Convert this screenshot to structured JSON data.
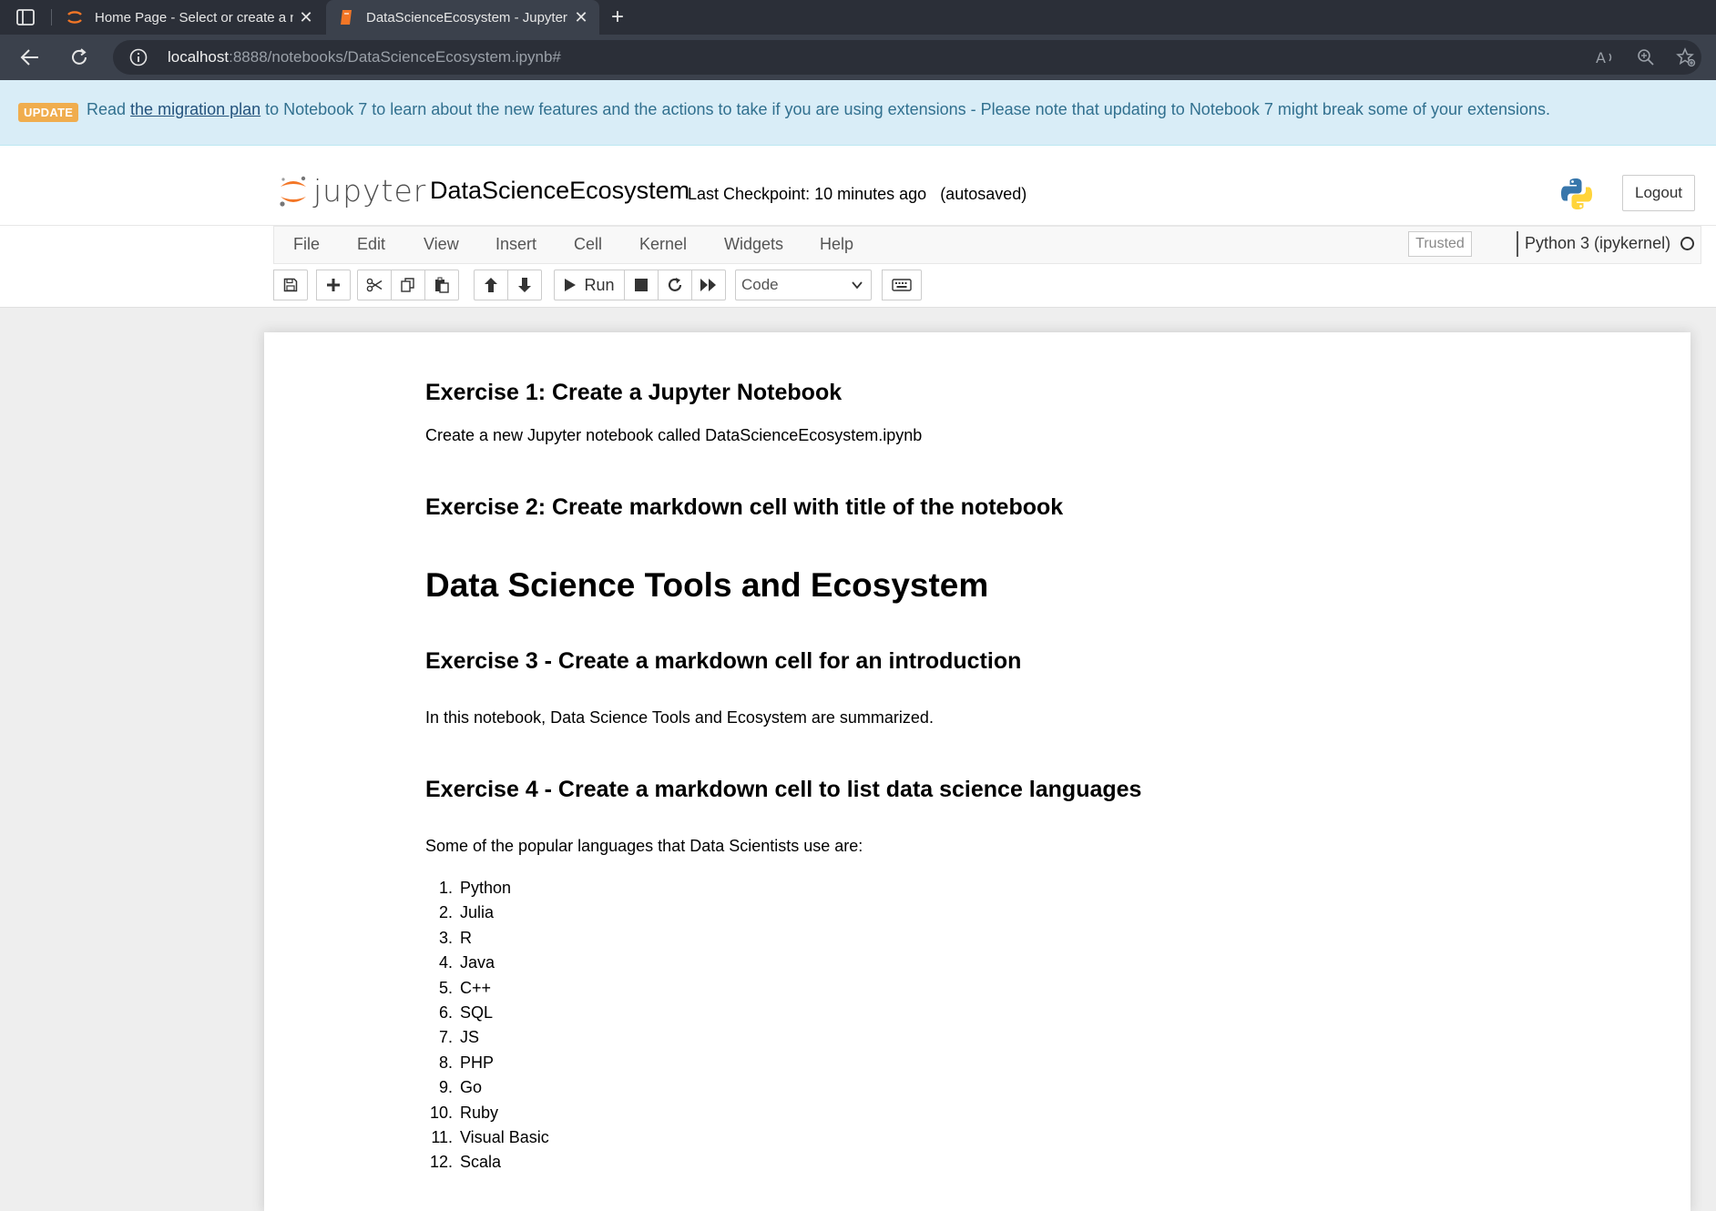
{
  "browser": {
    "tabs": [
      {
        "title": "Home Page - Select or create a n",
        "active": false
      },
      {
        "title": "DataScienceEcosystem - Jupyter",
        "active": true
      }
    ],
    "url_host": "localhost",
    "url_rest": ":8888/notebooks/DataScienceEcosystem.ipynb#"
  },
  "banner": {
    "badge": "UPDATE",
    "prefix": "Read ",
    "link": "the migration plan",
    "suffix": " to Notebook 7 to learn about the new features and the actions to take if you are using extensions - Please note that updating to Notebook 7 might break some of your extensions."
  },
  "header": {
    "logo_word": "jupyter",
    "notebook_name": "DataScienceEcosystem",
    "checkpoint": "Last Checkpoint: 10 minutes ago",
    "autosave": "(autosaved)",
    "logout": "Logout"
  },
  "menu": {
    "items": [
      "File",
      "Edit",
      "View",
      "Insert",
      "Cell",
      "Kernel",
      "Widgets",
      "Help"
    ],
    "trusted": "Trusted",
    "kernel": "Python 3 (ipykernel)"
  },
  "toolbar": {
    "run_label": "Run",
    "cell_type": "Code"
  },
  "cells": {
    "ex1_title": "Exercise 1: Create a Jupyter Notebook",
    "ex1_text": "Create a new Jupyter notebook called DataScienceEcosystem.ipynb",
    "ex2_title": "Exercise 2: Create markdown cell with title of the notebook",
    "main_title": "Data Science Tools and Ecosystem",
    "ex3_title": "Exercise 3 - Create a markdown cell for an introduction",
    "ex3_text": "In this notebook, Data Science Tools and Ecosystem are summarized.",
    "ex4_title": "Exercise 4 - Create a markdown cell to list data science languages",
    "ex4_text": "Some of the popular languages that Data Scientists use are:",
    "languages": [
      "Python",
      "Julia",
      "R",
      "Java",
      "C++",
      "SQL",
      "JS",
      "PHP",
      "Go",
      "Ruby",
      "Visual Basic",
      "Scala"
    ]
  },
  "colors": {
    "accent_orange": "#f37626",
    "banner_bg": "#d9edf7",
    "badge_bg": "#f0ad4e"
  }
}
